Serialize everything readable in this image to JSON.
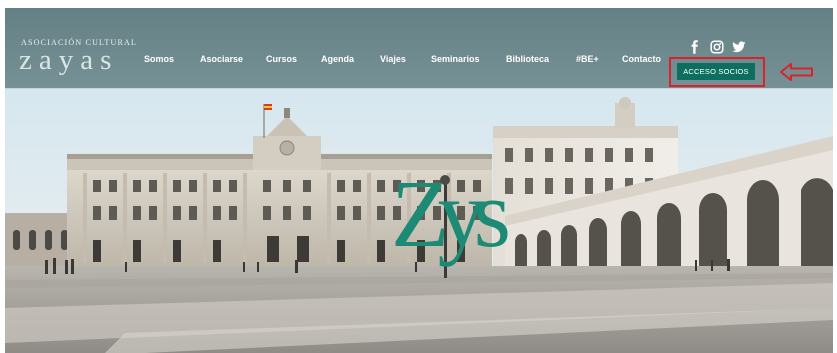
{
  "brand": {
    "tagline": "ASOCIACIÓN CULTURAL",
    "name": "zayas",
    "hero_monogram": "Zys"
  },
  "nav": {
    "items": [
      {
        "label": "Somos"
      },
      {
        "label": "Asociarse"
      },
      {
        "label": "Cursos"
      },
      {
        "label": "Agenda"
      },
      {
        "label": "Viajes"
      },
      {
        "label": "Seminarios"
      },
      {
        "label": "Biblioteca"
      },
      {
        "label": "#BE+"
      },
      {
        "label": "Contacto"
      }
    ],
    "social_icons": [
      "facebook-icon",
      "instagram-icon",
      "twitter-icon"
    ],
    "members_button": "ACCESO SOCIOS"
  },
  "colors": {
    "nav_bg": "#607c80",
    "accent_green": "#0c6e5f",
    "highlight_red": "#d8232a",
    "monogram": "#1c8a74"
  }
}
